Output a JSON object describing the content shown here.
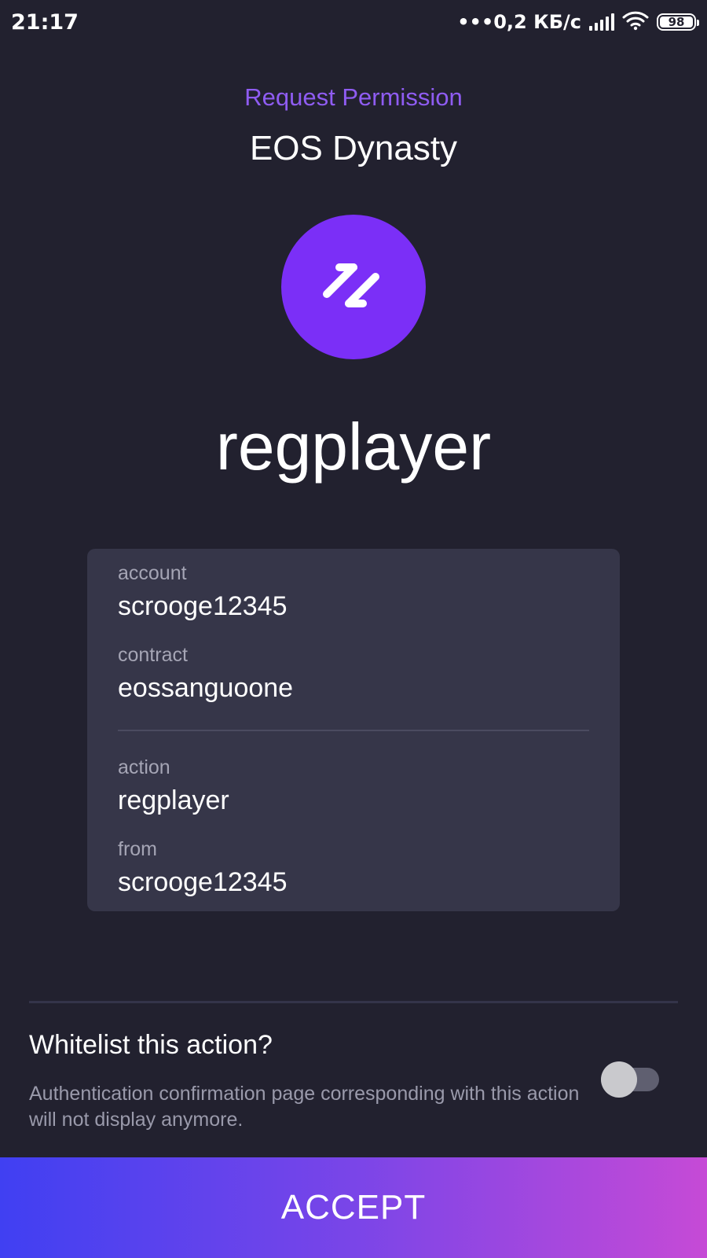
{
  "status_bar": {
    "time": "21:17",
    "network_speed": "•••0,2 КБ/с",
    "battery": "98",
    "signal_icon": "signal-bars-icon",
    "wifi_icon": "wifi-icon",
    "battery_icon": "battery-icon"
  },
  "header": {
    "request_permission": "Request Permission",
    "dapp_name": "EOS Dynasty"
  },
  "logo": {
    "icon": "eos-dynasty-logo-icon",
    "color": "#7b2ff7"
  },
  "action_title": "regplayer",
  "details": {
    "account_label": "account",
    "account_value": "scrooge12345",
    "contract_label": "contract",
    "contract_value": "eossanguoone",
    "action_label": "action",
    "action_value": "regplayer",
    "from_label": "from",
    "from_value": "scrooge12345"
  },
  "whitelist": {
    "title": "Whitelist this action?",
    "description": "Authentication confirmation page corresponding with this action will not display anymore.",
    "enabled": false
  },
  "accept_button": {
    "label": "ACCEPT"
  },
  "colors": {
    "background": "#22212f",
    "accent": "#8f5cf2",
    "card": "#363649",
    "button_gradient_start": "#4040f2",
    "button_gradient_end": "#c64ad6"
  }
}
